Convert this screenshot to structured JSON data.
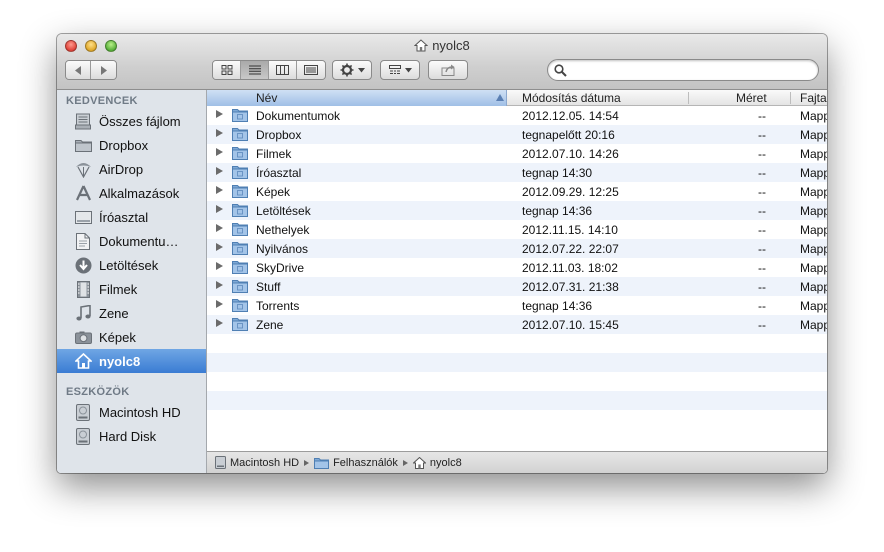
{
  "window": {
    "title": "nyolc8"
  },
  "toolbar": {
    "search_placeholder": ""
  },
  "sidebar": {
    "favorites_header": "KEDVENCEK",
    "devices_header": "ESZKÖZÖK",
    "favorites": [
      {
        "label": "Összes fájlom",
        "icon": "all-files-icon"
      },
      {
        "label": "Dropbox",
        "icon": "folder-icon"
      },
      {
        "label": "AirDrop",
        "icon": "airdrop-icon"
      },
      {
        "label": "Alkalmazások",
        "icon": "applications-icon"
      },
      {
        "label": "Íróasztal",
        "icon": "desktop-icon"
      },
      {
        "label": "Dokumentu…",
        "icon": "documents-icon"
      },
      {
        "label": "Letöltések",
        "icon": "downloads-icon"
      },
      {
        "label": "Filmek",
        "icon": "movies-icon"
      },
      {
        "label": "Zene",
        "icon": "music-icon"
      },
      {
        "label": "Képek",
        "icon": "pictures-icon"
      },
      {
        "label": "nyolc8",
        "icon": "home-icon",
        "selected": true
      }
    ],
    "devices": [
      {
        "label": "Macintosh HD",
        "icon": "hard-disk-icon"
      },
      {
        "label": "Hard Disk",
        "icon": "hard-disk-icon"
      }
    ]
  },
  "columns": {
    "name": "Név",
    "modified": "Módosítás dátuma",
    "size": "Méret",
    "kind": "Fajta"
  },
  "files": [
    {
      "name": "Dokumentumok",
      "modified": "2012.12.05. 14:54",
      "size": "--",
      "kind": "Mappa"
    },
    {
      "name": "Dropbox",
      "modified": "tegnapelőtt 20:16",
      "size": "--",
      "kind": "Mappa"
    },
    {
      "name": "Filmek",
      "modified": "2012.07.10. 14:26",
      "size": "--",
      "kind": "Mappa"
    },
    {
      "name": "Íróasztal",
      "modified": "tegnap 14:30",
      "size": "--",
      "kind": "Mappa"
    },
    {
      "name": "Képek",
      "modified": "2012.09.29. 12:25",
      "size": "--",
      "kind": "Mappa"
    },
    {
      "name": "Letöltések",
      "modified": "tegnap 14:36",
      "size": "--",
      "kind": "Mappa"
    },
    {
      "name": "Nethelyek",
      "modified": "2012.11.15. 14:10",
      "size": "--",
      "kind": "Mappa"
    },
    {
      "name": "Nyilvános",
      "modified": "2012.07.22. 22:07",
      "size": "--",
      "kind": "Mappa"
    },
    {
      "name": "SkyDrive",
      "modified": "2012.11.03. 18:02",
      "size": "--",
      "kind": "Mappa"
    },
    {
      "name": "Stuff",
      "modified": "2012.07.31. 21:38",
      "size": "--",
      "kind": "Mappa"
    },
    {
      "name": "Torrents",
      "modified": "tegnap 14:36",
      "size": "--",
      "kind": "Mappa"
    },
    {
      "name": "Zene",
      "modified": "2012.07.10. 15:45",
      "size": "--",
      "kind": "Mappa"
    }
  ],
  "pathbar": [
    {
      "label": "Macintosh HD",
      "icon": "hard-disk-icon"
    },
    {
      "label": "Felhasználók",
      "icon": "folder-icon"
    },
    {
      "label": "nyolc8",
      "icon": "home-icon"
    }
  ],
  "colors": {
    "selection": "#3a7cd3",
    "sidebar_bg": "#dfe4ea",
    "row_alt": "#eef3fb",
    "folder": "#7fa9d6"
  }
}
